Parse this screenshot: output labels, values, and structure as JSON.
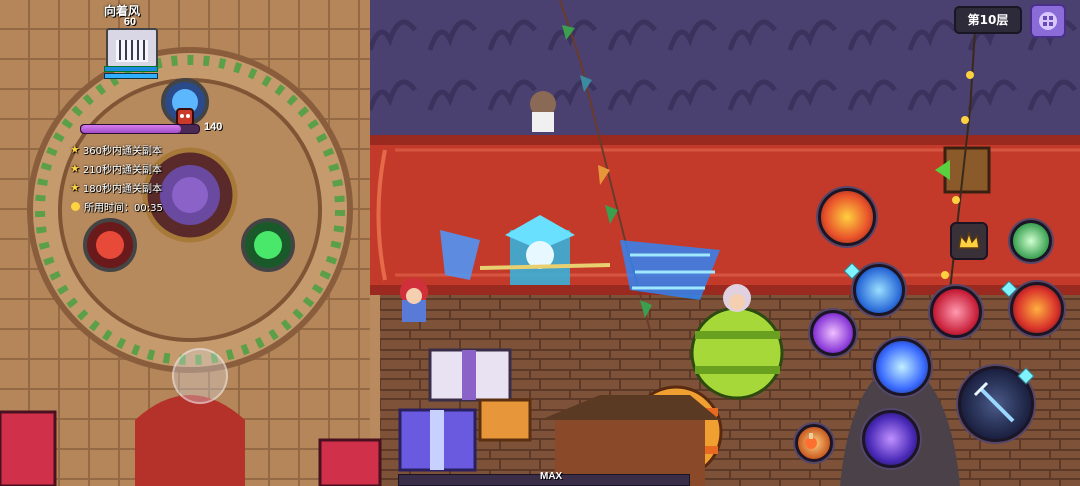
{
  "player": {
    "name": "向着风",
    "level": "60"
  },
  "boss": {
    "count": "140",
    "bar_level": 0.85
  },
  "quests": [
    {
      "icon": "star-icon",
      "text": "360秒内通关副本"
    },
    {
      "icon": "star-icon",
      "text": "210秒内通关副本"
    },
    {
      "icon": "star-icon",
      "text": "180秒内通关副本"
    }
  ],
  "timer": {
    "icon": "clock-icon",
    "text": "所用时间：00:35"
  },
  "floor": {
    "label": "第10层"
  },
  "exp_bar": {
    "label": "MAX"
  },
  "colors": {
    "boss_bar": "#b85fd8",
    "red_carpet": "#c43a2a",
    "floor_tile": "#8a5a3a",
    "star": "#ffd23f"
  }
}
